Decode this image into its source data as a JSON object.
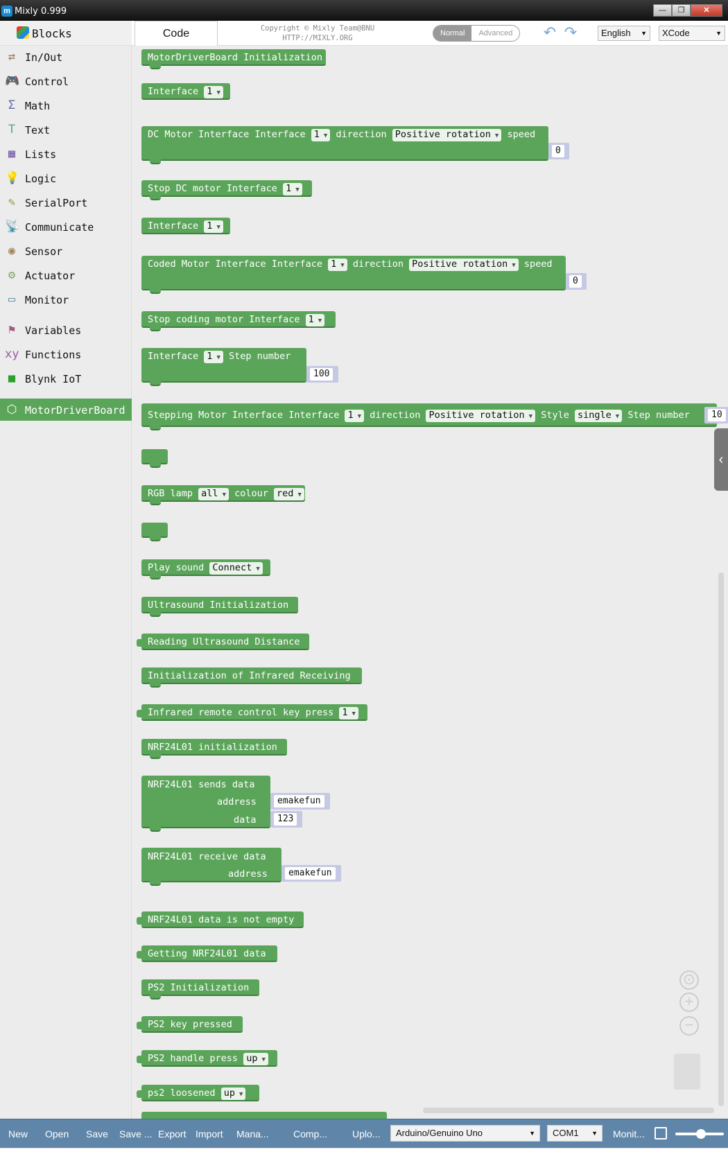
{
  "window": {
    "title": "Mixly 0.999",
    "app_icon_letter": "m",
    "minimize": "—",
    "maximize": "❐",
    "close": "✕"
  },
  "sidebar": {
    "blocks_label": "Blocks",
    "categories": [
      {
        "label": "In/Out",
        "icon": "⇄",
        "color": "#9a7a5a"
      },
      {
        "label": "Control",
        "icon": "🎮",
        "color": "#5ba55a"
      },
      {
        "label": "Math",
        "icon": "Σ",
        "color": "#5b67a5"
      },
      {
        "label": "Text",
        "icon": "T",
        "color": "#5ba58c"
      },
      {
        "label": "Lists",
        "icon": "▦",
        "color": "#745ba5"
      },
      {
        "label": "Logic",
        "icon": "💡",
        "color": "#5b80a5"
      },
      {
        "label": "SerialPort",
        "icon": "✎",
        "color": "#7fa53a"
      },
      {
        "label": "Communicate",
        "icon": "📡",
        "color": "#2e8b57"
      },
      {
        "label": "Sensor",
        "icon": "◉",
        "color": "#a5875b"
      },
      {
        "label": "Actuator",
        "icon": "⚙",
        "color": "#7fa55b"
      },
      {
        "label": "Monitor",
        "icon": "▭",
        "color": "#5b8ba5"
      },
      {
        "label": "Variables",
        "icon": "⚑",
        "color": "#a55b80"
      },
      {
        "label": "Functions",
        "icon": "xy",
        "color": "#995ba5"
      },
      {
        "label": "Blynk IoT",
        "icon": "■",
        "color": "#2ca02c"
      },
      {
        "label": "MotorDriverBoard",
        "icon": "⬡",
        "color": "#ffffff"
      }
    ]
  },
  "topbar": {
    "code_tab": "Code",
    "copyright_line1": "Copyright © Mixly Team@BNU",
    "copyright_line2": "HTTP://MIXLY.ORG",
    "mode_normal": "Normal",
    "mode_advanced": "Advanced",
    "undo_icon": "↶",
    "redo_icon": "↷",
    "language": "English",
    "code_target": "XCode"
  },
  "blocks": {
    "b1": "MotorDriverBoard Initialization",
    "b2": "Interface",
    "b2_dd": "1",
    "b3": "DC Motor Interface Interface",
    "b3_dd": "1",
    "b3_dir": "direction",
    "b3_dir_dd": "Positive rotation",
    "b3_speed": "speed",
    "b3_val": "0",
    "b4": "Stop DC motor Interface",
    "b4_dd": "1",
    "b5": "Interface",
    "b5_dd": "1",
    "b6": "Coded Motor Interface Interface",
    "b6_dd": "1",
    "b6_dir": "direction",
    "b6_dir_dd": "Positive rotation",
    "b6_speed": "speed",
    "b6_val": "0",
    "b7": "Stop coding motor Interface",
    "b7_dd": "1",
    "b8": "Interface",
    "b8_dd": "1",
    "b8_step": "Step number",
    "b8_val": "100",
    "b9": "Stepping Motor Interface Interface",
    "b9_dd": "1",
    "b9_dir": "direction",
    "b9_dir_dd": "Positive rotation",
    "b9_style": "Style",
    "b9_style_dd": "single",
    "b9_step": "Step number",
    "b9_val": "10",
    "b10": "RGB lamp",
    "b10_dd": "all",
    "b10_colour": "colour",
    "b10_colour_dd": "red",
    "b11": "Play sound",
    "b11_dd": "Connect",
    "b12": "Ultrasound Initialization",
    "b13": "Reading Ultrasound Distance",
    "b14": "Initialization of Infrared Receiving",
    "b15": "Infrared remote control key press",
    "b15_dd": "1",
    "b16": "NRF24L01 initialization",
    "b17": "NRF24L01 sends data",
    "b17_addr": "address",
    "b17_addr_val": "emakefun",
    "b17_data": "data",
    "b17_data_val": "123",
    "b18": "NRF24L01 receive data",
    "b18_addr": "address",
    "b18_addr_val": "emakefun",
    "b19": "NRF24L01 data is not empty",
    "b20": "Getting NRF24L01 data",
    "b21": "PS2 Initialization",
    "b22": "PS2 key pressed",
    "b23": "PS2 handle press",
    "b23_dd": "up",
    "b24": "ps2  loosened",
    "b24_dd": "up"
  },
  "workspace": {
    "collapse_icon": "‹",
    "recenter_icon": "⊙",
    "zoom_in_icon": "+",
    "zoom_out_icon": "−"
  },
  "footer": {
    "new": "New",
    "open": "Open",
    "save": "Save",
    "save_as": "Save ...",
    "export": "Export",
    "import": "Import",
    "manage": "Mana...",
    "compile": "Comp...",
    "upload": "Uplo...",
    "board": "Arduino/Genuino Uno",
    "port": "COM1",
    "monitor": "Monit..."
  },
  "colors": {
    "block_green": "#5ba55a",
    "footer_blue": "#5f86a8",
    "value_lilac": "#c5c9e3"
  }
}
